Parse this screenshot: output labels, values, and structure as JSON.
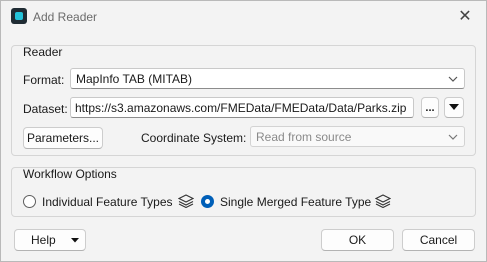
{
  "window": {
    "title": "Add Reader",
    "close_glyph": "✕"
  },
  "reader": {
    "group_label": "Reader",
    "format_label": "Format:",
    "format_value": "MapInfo TAB (MITAB)",
    "dataset_label": "Dataset:",
    "dataset_value": "https://s3.amazonaws.com/FMEData/FMEData/Data/Parks.zip",
    "browse_label": "...",
    "parameters_label": "Parameters...",
    "coord_label": "Coordinate System:",
    "coord_placeholder": "Read from source"
  },
  "workflow": {
    "group_label": "Workflow Options",
    "options": [
      {
        "label": "Individual Feature Types",
        "selected": false,
        "icon": "layers-icon"
      },
      {
        "label": "Single Merged Feature Type",
        "selected": true,
        "icon": "layers-icon"
      }
    ]
  },
  "footer": {
    "help_label": "Help",
    "ok_label": "OK",
    "cancel_label": "Cancel"
  },
  "colors": {
    "accent": "#005fb8",
    "app_icon": "#23c2d9"
  }
}
